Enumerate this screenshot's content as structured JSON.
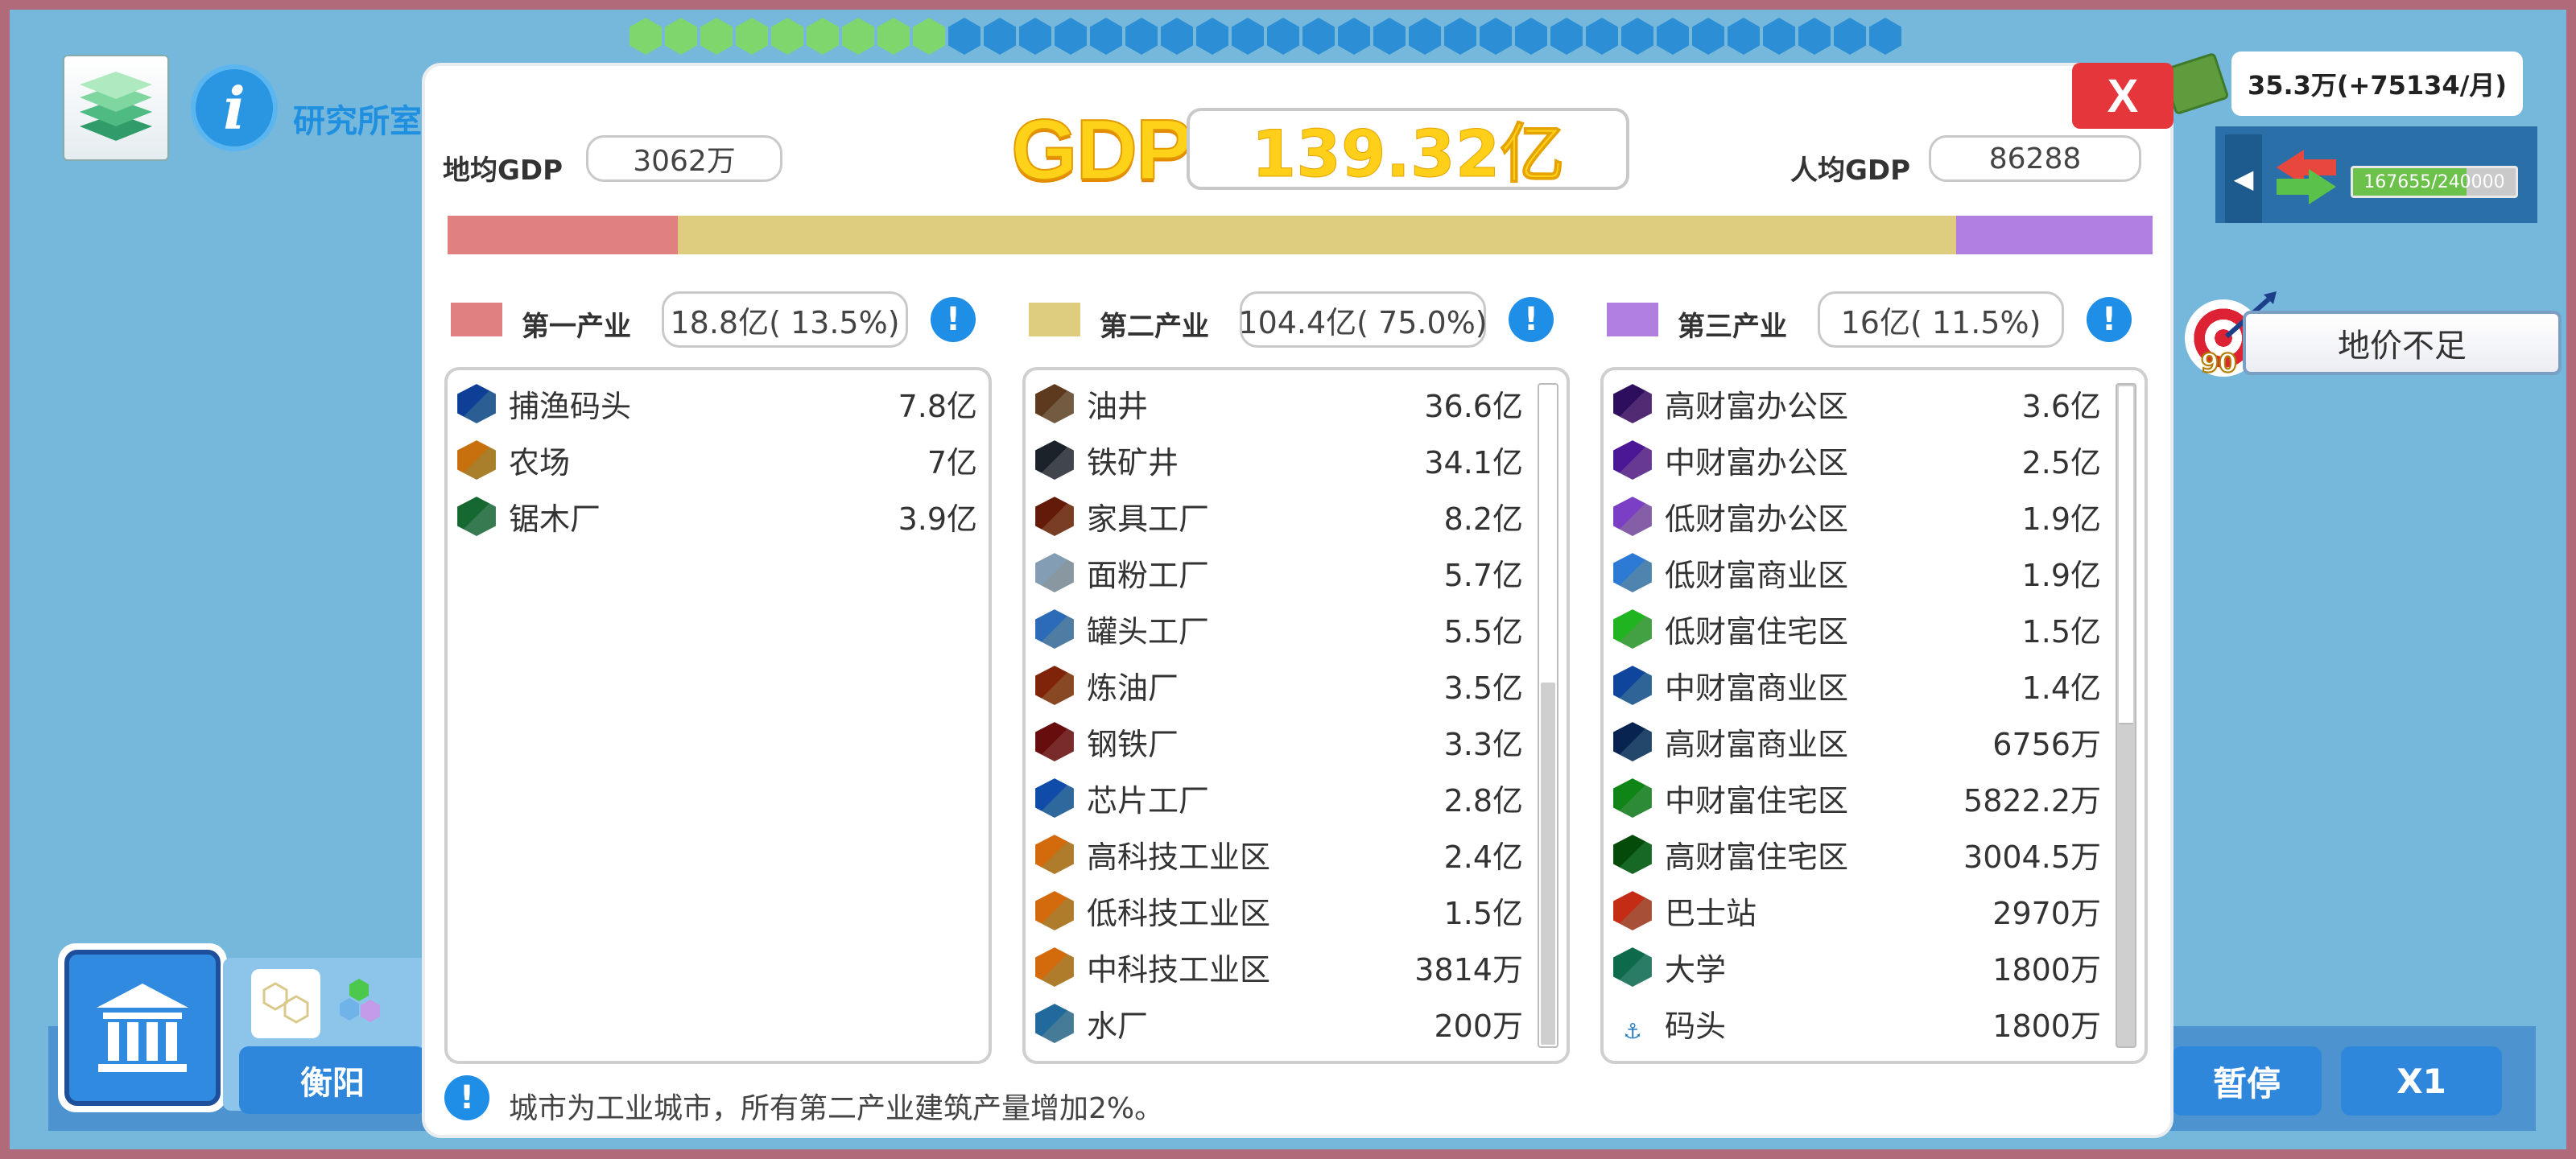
{
  "hud": {
    "research_label": "研究所室",
    "money": "35.3万(+75134/月)",
    "population": "167655/240000",
    "population_fill": 0.7,
    "target_count": "90",
    "land_price_button": "地价不足",
    "city_name": "衡阳",
    "pause_label": "暂停",
    "speed_label": "X1"
  },
  "modal": {
    "close_label": "X",
    "gdp_title": "GDP",
    "gdp_total": "139.32亿",
    "land_gdp_label": "地均GDP",
    "land_gdp_value": "3062万",
    "per_capita_label": "人均GDP",
    "per_capita_value": "86288",
    "footer_note": "城市为工业城市，所有第二产业建筑产量增加2%。"
  },
  "colors": {
    "primary": "#e08080",
    "secondary": "#decd7e",
    "tertiary": "#b07fe0",
    "gdp_gold": "#ffd21a",
    "close_red": "#e5373b"
  },
  "chart_data": {
    "type": "bar",
    "categories": [
      "第一产业",
      "第二产业",
      "第三产业"
    ],
    "values": [
      13.5,
      75.0,
      11.5
    ]
  },
  "sectors": [
    {
      "name": "第一产业",
      "summary": "18.8亿( 13.5%)",
      "color": "#e08080",
      "scroll": false,
      "items": [
        {
          "icon": "fishing-dock-icon",
          "name": "捕渔码头",
          "value": "7.8亿"
        },
        {
          "icon": "farm-icon",
          "name": "农场",
          "value": "7亿"
        },
        {
          "icon": "sawmill-icon",
          "name": "锯木厂",
          "value": "3.9亿"
        }
      ]
    },
    {
      "name": "第二产业",
      "summary": "104.4亿( 75.0%)",
      "color": "#decd7e",
      "scroll": true,
      "items": [
        {
          "icon": "oil-well-icon",
          "name": "油井",
          "value": "36.6亿"
        },
        {
          "icon": "iron-mine-icon",
          "name": "铁矿井",
          "value": "34.1亿"
        },
        {
          "icon": "furniture-factory-icon",
          "name": "家具工厂",
          "value": "8.2亿"
        },
        {
          "icon": "flour-factory-icon",
          "name": "面粉工厂",
          "value": "5.7亿"
        },
        {
          "icon": "cannery-icon",
          "name": "罐头工厂",
          "value": "5.5亿"
        },
        {
          "icon": "refinery-icon",
          "name": "炼油厂",
          "value": "3.5亿"
        },
        {
          "icon": "steel-mill-icon",
          "name": "钢铁厂",
          "value": "3.3亿"
        },
        {
          "icon": "chip-factory-icon",
          "name": "芯片工厂",
          "value": "2.8亿"
        },
        {
          "icon": "high-tech-zone-icon",
          "name": "高科技工业区",
          "value": "2.4亿"
        },
        {
          "icon": "low-tech-zone-icon",
          "name": "低科技工业区",
          "value": "1.5亿"
        },
        {
          "icon": "mid-tech-zone-icon",
          "name": "中科技工业区",
          "value": "3814万"
        },
        {
          "icon": "water-plant-icon",
          "name": "水厂",
          "value": "200万"
        }
      ]
    },
    {
      "name": "第三产业",
      "summary": "16亿( 11.5%)",
      "color": "#b07fe0",
      "scroll": true,
      "items": [
        {
          "icon": "high-office-icon",
          "name": "高财富办公区",
          "value": "3.6亿"
        },
        {
          "icon": "mid-office-icon",
          "name": "中财富办公区",
          "value": "2.5亿"
        },
        {
          "icon": "low-office-icon",
          "name": "低财富办公区",
          "value": "1.9亿"
        },
        {
          "icon": "low-commercial-icon",
          "name": "低财富商业区",
          "value": "1.9亿"
        },
        {
          "icon": "low-residential-icon",
          "name": "低财富住宅区",
          "value": "1.5亿"
        },
        {
          "icon": "mid-commercial-icon",
          "name": "中财富商业区",
          "value": "1.4亿"
        },
        {
          "icon": "high-commercial-icon",
          "name": "高财富商业区",
          "value": "6756万"
        },
        {
          "icon": "mid-residential-icon",
          "name": "中财富住宅区",
          "value": "5822.2万"
        },
        {
          "icon": "high-residential-icon",
          "name": "高财富住宅区",
          "value": "3004.5万"
        },
        {
          "icon": "bus-station-icon",
          "name": "巴士站",
          "value": "2970万"
        },
        {
          "icon": "university-icon",
          "name": "大学",
          "value": "1800万"
        },
        {
          "icon": "port-icon",
          "name": "码头",
          "value": "1800万"
        }
      ]
    }
  ]
}
